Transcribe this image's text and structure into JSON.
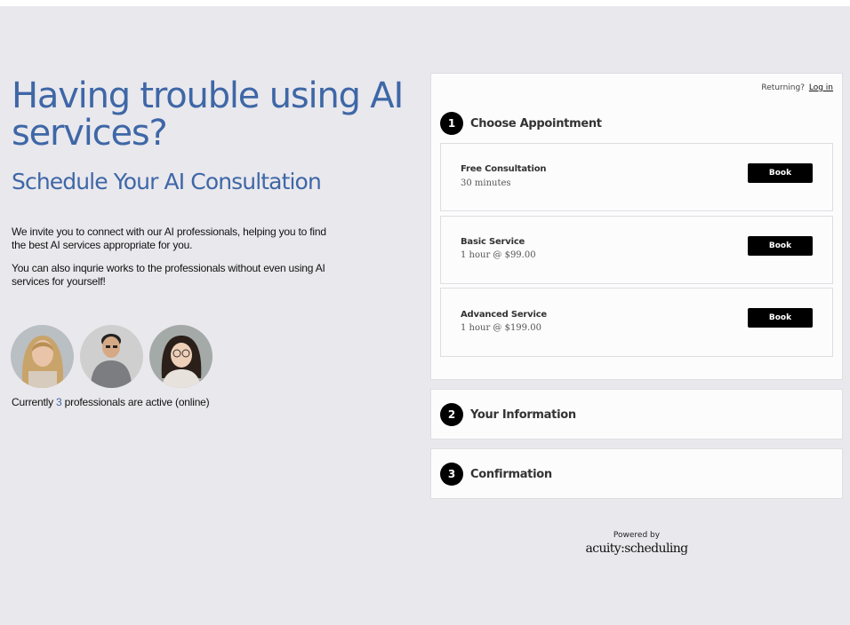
{
  "hero": {
    "title": "Having trouble using AI services?",
    "subtitle": "Schedule Your AI Consultation",
    "paragraph1": "We invite you to connect with our AI professionals, helping you to find the best AI services appropriate for you.",
    "paragraph2": "You can also inqurie works to the professionals without even using AI services for yourself!"
  },
  "professionals": {
    "active_prefix": "Currently ",
    "active_count": "3",
    "active_suffix": " professionals are active (online)"
  },
  "scheduler": {
    "returning_label": "Returning?",
    "login_label": "Log in",
    "steps": [
      {
        "number": "1",
        "label": "Choose Appointment"
      },
      {
        "number": "2",
        "label": "Your Information"
      },
      {
        "number": "3",
        "label": "Confirmation"
      }
    ],
    "services": [
      {
        "name": "Free Consultation",
        "detail": "30 minutes",
        "button": "Book"
      },
      {
        "name": "Basic Service",
        "detail": "1 hour @ $99.00",
        "button": "Book"
      },
      {
        "name": "Advanced Service",
        "detail": "1 hour @ $199.00",
        "button": "Book"
      }
    ]
  },
  "footer": {
    "powered_by": "Powered by",
    "brand": "acuity:scheduling"
  },
  "colors": {
    "accent": "#3e67a6",
    "background": "#e9e8ed",
    "button": "#000000"
  }
}
